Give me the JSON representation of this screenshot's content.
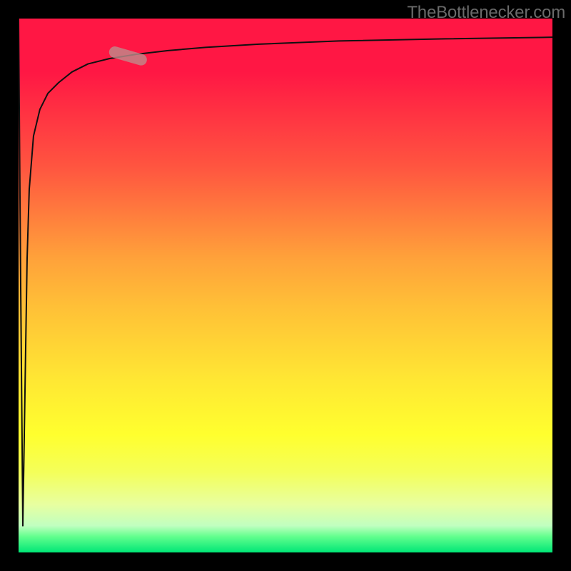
{
  "attribution": "TheBottlenecker.com",
  "chart_data": {
    "type": "line",
    "title": "",
    "xlabel": "",
    "ylabel": "",
    "xlim": [
      0,
      100
    ],
    "ylim": [
      0,
      100
    ],
    "background_gradient": {
      "direction": "vertical_top_to_bottom",
      "stops": [
        {
          "pos": 0.0,
          "color": "#ff1744"
        },
        {
          "pos": 0.28,
          "color": "#ff5640"
        },
        {
          "pos": 0.54,
          "color": "#ffc037"
        },
        {
          "pos": 0.78,
          "color": "#ffff2e"
        },
        {
          "pos": 0.95,
          "color": "#c0ffc0"
        },
        {
          "pos": 1.0,
          "color": "#00e676"
        }
      ]
    },
    "series": [
      {
        "name": "curve",
        "x": [
          0.0,
          0.4,
          0.8,
          1.2,
          1.6,
          2.0,
          2.8,
          4.0,
          5.5,
          7.5,
          10,
          13,
          17,
          22,
          28,
          35,
          45,
          60,
          80,
          100
        ],
        "y": [
          100,
          50,
          5,
          30,
          55,
          68,
          78,
          83,
          86,
          88,
          90,
          91.5,
          92.5,
          93.3,
          94.0,
          94.6,
          95.2,
          95.8,
          96.2,
          96.5
        ]
      }
    ],
    "annotations": [
      {
        "name": "highlight-pill",
        "shape": "rounded_segment",
        "x_range": [
          17,
          24
        ],
        "y_range": [
          92,
          94
        ],
        "color": "rgba(190,140,140,0.80)"
      }
    ]
  }
}
